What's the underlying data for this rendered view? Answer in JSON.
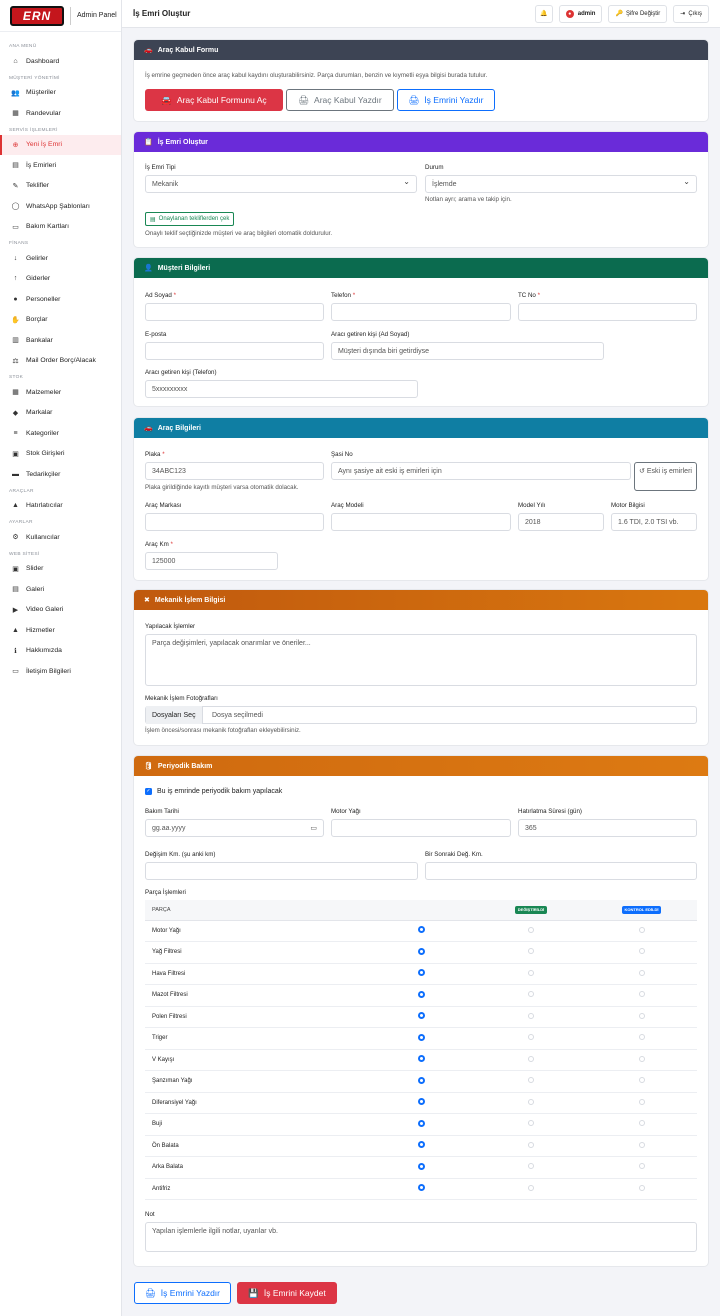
{
  "brand": {
    "logo_text": "ERN",
    "admin_label": "Admin Panel"
  },
  "sidebar": {
    "sections": [
      {
        "title": "ANA MENÜ",
        "items": [
          {
            "label": "Dashboard",
            "icon": "home-icon"
          }
        ]
      },
      {
        "title": "MÜŞTERİ YÖNETİMİ",
        "items": [
          {
            "label": "Müşteriler",
            "icon": "users-icon"
          },
          {
            "label": "Randevular",
            "icon": "calendar-icon"
          }
        ]
      },
      {
        "title": "SERVİS İŞLEMLERİ",
        "items": [
          {
            "label": "Yeni İş Emri",
            "icon": "plus-circle-icon",
            "active": true
          },
          {
            "label": "İş Emirleri",
            "icon": "clipboard-icon"
          },
          {
            "label": "Teklifler",
            "icon": "file-signature-icon"
          },
          {
            "label": "WhatsApp Şablonları",
            "icon": "whatsapp-icon"
          },
          {
            "label": "Bakım Kartları",
            "icon": "id-card-icon"
          }
        ]
      },
      {
        "title": "FİNANS",
        "items": [
          {
            "label": "Gelirler",
            "icon": "arrow-down-icon"
          },
          {
            "label": "Giderler",
            "icon": "arrow-up-icon"
          },
          {
            "label": "Personeller",
            "icon": "user-icon"
          },
          {
            "label": "Borçlar",
            "icon": "hand-holding-icon"
          },
          {
            "label": "Bankalar",
            "icon": "bank-icon"
          },
          {
            "label": "Mail Order Borç/Alacak",
            "icon": "balance-scale-icon"
          }
        ]
      },
      {
        "title": "STOK",
        "items": [
          {
            "label": "Malzemeler",
            "icon": "boxes-icon"
          },
          {
            "label": "Markalar",
            "icon": "tags-icon"
          },
          {
            "label": "Kategoriler",
            "icon": "layers-icon"
          },
          {
            "label": "Stok Girişleri",
            "icon": "dolly-icon"
          },
          {
            "label": "Tedarikçiler",
            "icon": "truck-icon"
          }
        ]
      },
      {
        "title": "ARAÇLAR",
        "items": [
          {
            "label": "Hatırlatıcılar",
            "icon": "bell-icon"
          }
        ]
      },
      {
        "title": "AYARLAR",
        "items": [
          {
            "label": "Kullanıcılar",
            "icon": "user-cog-icon"
          }
        ]
      },
      {
        "title": "WEB SİTESİ",
        "items": [
          {
            "label": "Slider",
            "icon": "images-icon"
          },
          {
            "label": "Galeri",
            "icon": "gallery-icon"
          },
          {
            "label": "Video Galeri",
            "icon": "video-icon"
          },
          {
            "label": "Hizmetler",
            "icon": "car-service-icon"
          },
          {
            "label": "Hakkımızda",
            "icon": "info-icon"
          },
          {
            "label": "İletişim Bilgileri",
            "icon": "contact-card-icon"
          }
        ]
      }
    ]
  },
  "topbar": {
    "title": "İş Emri Oluştur",
    "user": "admin",
    "change_password": "Şifre Değiştir",
    "logout": "Çıkış"
  },
  "kabul": {
    "header": "Araç Kabul Formu",
    "desc": "İş emrine geçmeden önce araç kabul kaydını oluşturabilirsiniz. Parça durumları, benzin ve kıymetli eşya bilgisi burada tutulur.",
    "btn_open": "Araç Kabul Formunu Aç",
    "btn_print_kabul": "Araç Kabul Yazdır",
    "btn_print_is": "İş Emrini Yazdır"
  },
  "olustur": {
    "header": "İş Emri Oluştur",
    "tip_label": "İş Emri Tipi",
    "tip_value": "Mekanik",
    "durum_label": "Durum",
    "durum_value": "İşlemde",
    "durum_help": "Notlan ayrı; arama ve takip için.",
    "teklif_btn": "Onaylanan tekliflerden çek",
    "teklif_help": "Onaylı teklif seçtiğinizde müşteri ve araç bilgileri otomatik doldurulur."
  },
  "musteri": {
    "header": "Müşteri Bilgileri",
    "ad_label": "Ad Soyad",
    "tel_label": "Telefon",
    "tc_label": "TC No",
    "eposta_label": "E-posta",
    "getiren_label": "Aracı getiren kişi (Ad Soyad)",
    "getiren_placeholder": "Müşteri dışında biri getirdiyse",
    "getiren_tel_label": "Aracı getiren kişi (Telefon)",
    "getiren_tel_placeholder": "5xxxxxxxxx"
  },
  "arac": {
    "header": "Araç Bilgileri",
    "plaka_label": "Plaka",
    "plaka_value": "34ABC123",
    "plaka_help": "Plaka girildiğinde kayıtlı müşteri varsa otomatik dolacak.",
    "sasi_label": "Şasi No",
    "sasi_placeholder": "Aynı şasiye ait eski iş emirleri için",
    "eski_btn": "Eski iş emirleri",
    "marka_label": "Araç Markası",
    "model_label": "Araç Modeli",
    "yil_label": "Model Yılı",
    "yil_value": "2018",
    "motor_label": "Motor Bilgisi",
    "motor_placeholder": "1.6 TDI, 2.0 TSI vb.",
    "km_label": "Araç Km",
    "km_value": "125000"
  },
  "mekanik": {
    "header": "Mekanik İşlem Bilgisi",
    "yapilacak_label": "Yapılacak İşlemler",
    "yapilacak_placeholder": "Parça değişimleri, yapılacak onarımlar ve öneriler...",
    "foto_label": "Mekanik İşlem Fotoğrafları",
    "file_btn": "Dosyaları Seç",
    "file_status": "Dosya seçilmedi",
    "foto_help": "İşlem öncesi/sonrası mekanik fotoğrafları ekleyebilirsiniz."
  },
  "bakim": {
    "header": "Periyodik Bakım",
    "checkbox_label": "Bu iş emrinde periyodik bakım yapılacak",
    "tarih_label": "Bakım Tarihi",
    "tarih_placeholder": "gg.aa.yyyy",
    "yag_label": "Motor Yağı",
    "hatirlatma_label": "Hatırlatma Süresi (gün)",
    "hatirlatma_value": "365",
    "degisim_label": "Değişim Km. (şu anki km)",
    "sonraki_label": "Bir Sonraki Değ. Km.",
    "parca_label": "Parça İşlemleri",
    "col_parca": "PARÇA",
    "col_degisti": "DEĞİŞTİRİLDİ",
    "col_kontrol": "KONTROL EDİLDİ",
    "parts": [
      "Motor Yağı",
      "Yağ Filtresi",
      "Hava Filtresi",
      "Mazot Filtresi",
      "Polen Filtresi",
      "Triger",
      "V Kayışı",
      "Şanzıman Yağı",
      "Diferansiyel Yağı",
      "Buji",
      "Ön Balata",
      "Arka Balata",
      "Antifriz"
    ],
    "not_label": "Not",
    "not_placeholder": "Yapılan işlemlerle ilgili notlar, uyarılar vb."
  },
  "footer": {
    "print_btn": "İş Emrini Yazdır",
    "save_btn": "İş Emrini Kaydet"
  },
  "colors": {
    "accent_red": "#dc3545",
    "kabul_header": "#3d4454",
    "olustur_header": "#6a2bd9",
    "musteri_header": "#0b6b4f",
    "arac_header": "#0f7ea3",
    "mekanik_header": "#c0590e",
    "bakim_header": "#cf6a10"
  }
}
